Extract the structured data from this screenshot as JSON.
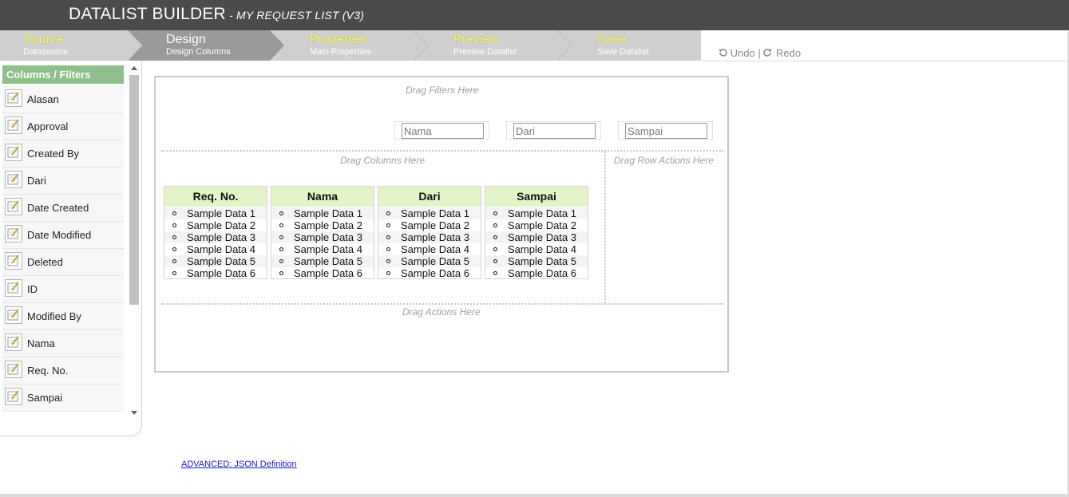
{
  "header": {
    "title": "DATALIST BUILDER",
    "subtitle": " - MY REQUEST LIST (V3)"
  },
  "steps": [
    {
      "title": "Source",
      "sub": "Datasource"
    },
    {
      "title": "Design",
      "sub": "Design Columns"
    },
    {
      "title": "Properties",
      "sub": "Main Properties"
    },
    {
      "title": "Preview",
      "sub": "Preview Datalist"
    },
    {
      "title": "Save",
      "sub": "Save Datalist"
    }
  ],
  "toolbar": {
    "undo": "Undo",
    "separator": "|",
    "redo": "Redo"
  },
  "sidebar": {
    "heading": "Columns / Filters",
    "items": [
      "Alasan",
      "Approval",
      "Created By",
      "Dari",
      "Date Created",
      "Date Modified",
      "Deleted",
      "ID",
      "Modified By",
      "Nama",
      "Req. No.",
      "Sampai"
    ]
  },
  "canvas": {
    "hints": {
      "filters": "Drag Filters Here",
      "columns": "Drag Columns Here",
      "row_actions": "Drag Row Actions Here",
      "actions": "Drag Actions Here"
    },
    "filters": [
      {
        "value": "Nama"
      },
      {
        "value": "Dari"
      },
      {
        "value": "Sampai"
      }
    ],
    "columns": [
      {
        "header": "Req. No.",
        "rows": [
          "Sample Data 1",
          "Sample Data 2",
          "Sample Data 3",
          "Sample Data 4",
          "Sample Data 5",
          "Sample Data 6"
        ]
      },
      {
        "header": "Nama",
        "rows": [
          "Sample Data 1",
          "Sample Data 2",
          "Sample Data 3",
          "Sample Data 4",
          "Sample Data 5",
          "Sample Data 6"
        ]
      },
      {
        "header": "Dari",
        "rows": [
          "Sample Data 1",
          "Sample Data 2",
          "Sample Data 3",
          "Sample Data 4",
          "Sample Data 5",
          "Sample Data 6"
        ]
      },
      {
        "header": "Sampai",
        "rows": [
          "Sample Data 1",
          "Sample Data 2",
          "Sample Data 3",
          "Sample Data 4",
          "Sample Data 5",
          "Sample Data 6"
        ]
      }
    ]
  },
  "footer": {
    "advanced_link": "ADVANCED: JSON Definition"
  },
  "icons": {
    "undo": "undo-icon",
    "redo": "redo-icon",
    "edit": "edit-icon"
  },
  "colors": {
    "header_bg": "#4b4b4b",
    "step_active": "#9a9a9a",
    "step_title": "#f5f56e",
    "sidebar_head": "#8fbf8a",
    "column_head": "#e3f5c8"
  }
}
